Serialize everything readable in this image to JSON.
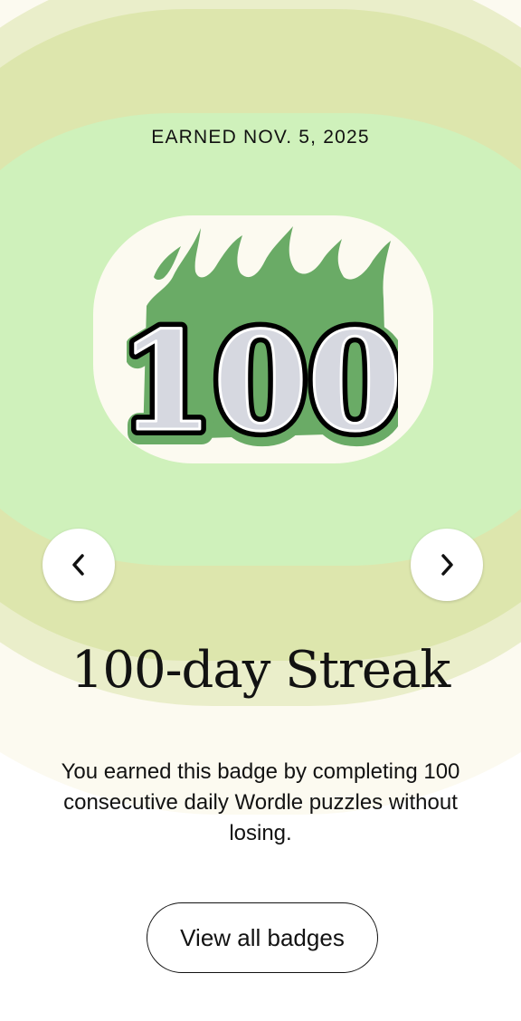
{
  "badge": {
    "earned_label": "EARNED NOV. 5, 2025",
    "number": "100",
    "title": "100-day Streak",
    "description": "You earned this badge by completing 100 consecutive daily Wordle puzzles without losing."
  },
  "navigation": {
    "prev_icon": "chevron-left-icon",
    "next_icon": "chevron-right-icon"
  },
  "actions": {
    "view_all_label": "View all badges"
  },
  "colors": {
    "flame": "#6aab66",
    "ring_pale": "#fcfaf0",
    "ring_light": "#eaeeca",
    "ring_olive": "#dde6ad",
    "ring_mint": "#cff1bb",
    "digits_fill": "#d6d8e0"
  }
}
